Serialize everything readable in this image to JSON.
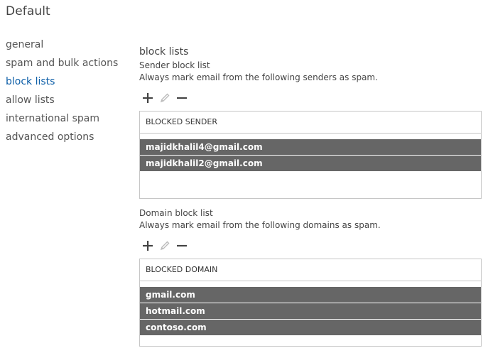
{
  "page": {
    "title": "Default"
  },
  "nav": {
    "items": [
      {
        "label": "general",
        "active": false
      },
      {
        "label": "spam and bulk actions",
        "active": false
      },
      {
        "label": "block lists",
        "active": true
      },
      {
        "label": "allow lists",
        "active": false
      },
      {
        "label": "international spam",
        "active": false
      },
      {
        "label": "advanced options",
        "active": false
      }
    ]
  },
  "main": {
    "section_title": "block lists",
    "sender": {
      "title": "Sender block list",
      "description": "Always mark email from the following senders as spam.",
      "column_header": "BLOCKED SENDER",
      "rows": [
        "majidkhalil4@gmail.com",
        "majidkhalil2@gmail.com"
      ]
    },
    "domain": {
      "title": "Domain block list",
      "description": "Always mark email from the following domains as spam.",
      "column_header": "BLOCKED DOMAIN",
      "rows": [
        "gmail.com",
        "hotmail.com",
        "contoso.com"
      ]
    }
  },
  "icons": {
    "add": "plus-icon",
    "edit": "pencil-icon",
    "remove": "minus-icon"
  },
  "colors": {
    "active_nav": "#0e5fa8",
    "selected_row": "#666666",
    "border": "#c6c6c6"
  }
}
